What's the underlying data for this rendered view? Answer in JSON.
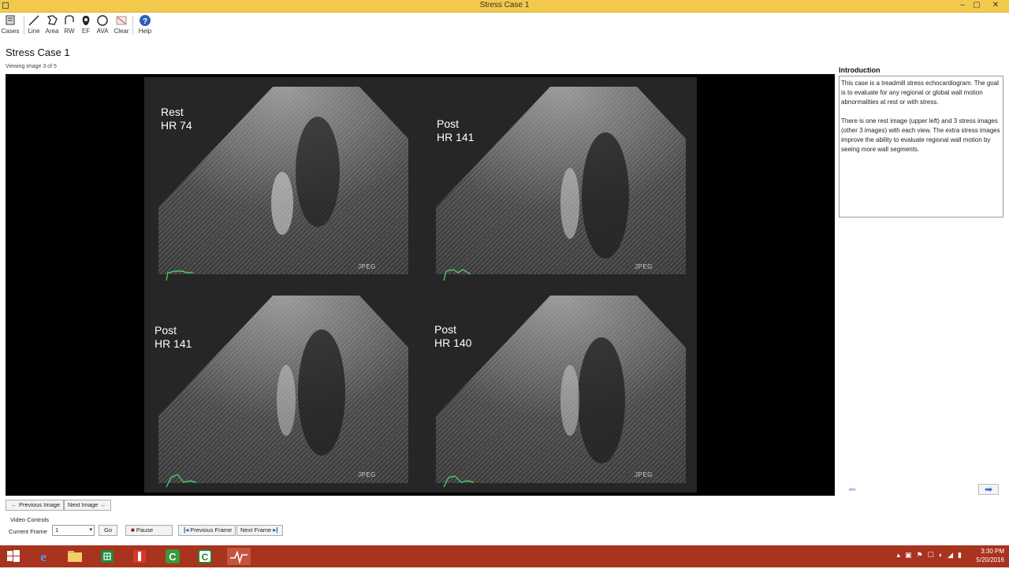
{
  "window": {
    "title": "Stress Case 1",
    "controls": [
      "–",
      "▢",
      "✕"
    ]
  },
  "toolbar": {
    "items": [
      {
        "label": "Cases",
        "icon": "cases-icon"
      },
      {
        "label": "Line",
        "icon": "line-icon"
      },
      {
        "label": "Area",
        "icon": "area-icon"
      },
      {
        "label": "RW",
        "icon": "rw-icon"
      },
      {
        "label": "EF",
        "icon": "ef-icon"
      },
      {
        "label": "AVA",
        "icon": "ava-icon"
      },
      {
        "label": "Clear",
        "icon": "clear-icon"
      },
      {
        "label": "Help",
        "icon": "help-icon"
      }
    ]
  },
  "page": {
    "title": "Stress Case 1",
    "viewing": "Viewing image 3 of 5"
  },
  "viewer": {
    "quadrants": [
      {
        "label": "Rest\nHR 74",
        "watermark": "JPEG"
      },
      {
        "label": "Post\nHR 141",
        "watermark": "JPEG"
      },
      {
        "label": "Post\nHR 141",
        "watermark": "JPEG"
      },
      {
        "label": "Post\nHR 140",
        "watermark": "JPEG"
      }
    ]
  },
  "intro": {
    "title": "Introduction",
    "paragraphs": [
      "This case is a treadmill stress echocardiogram. The goal is to evaluate for any regional or global wall motion abnormalities at rest or with stress.",
      "There is one rest image (upper left) and 3 stress images (other 3 images) with each view. The extra stress images improve the ability to evaluate regional wall motion by seeing more wall segments."
    ]
  },
  "nav": {
    "previous_image": "Previous Image",
    "next_image": "Next Image",
    "prev_arrow": "⬅",
    "next_arrow": "➡"
  },
  "video": {
    "section_label": "Video Controls",
    "current_frame_label": "Current Frame",
    "current_frame_value": "1",
    "go": "Go",
    "pause": "Pause",
    "previous_frame": "Previous Frame",
    "next_frame": "Next Frame"
  },
  "taskbar": {
    "time": "3:30 PM",
    "date": "5/20/2016",
    "apps": [
      "start",
      "internet-explorer",
      "file-explorer",
      "spreadsheet-app",
      "office-app",
      "camtasia-app",
      "camtasia-recorder-app",
      "echo-app"
    ]
  },
  "colors": {
    "titlebar": "#f2c94c",
    "taskbar": "#a8331f",
    "viewer_bg": "#000000"
  }
}
